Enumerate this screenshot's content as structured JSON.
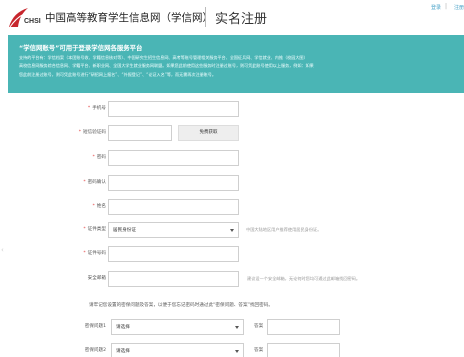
{
  "header": {
    "logo_en": "CHSI",
    "logo_cn": "中国高等教育学生信息网（学信网）",
    "page_title": "实名注册",
    "login_link": "登录",
    "separator": "|",
    "register_link": "注册"
  },
  "banner": {
    "title": "“学信网账号”可用于登录学信网各服务平台",
    "lines": [
      "支持的平台有：学信档案（本团账号收、学籍信息核对等）、中国研究生招生信息网、高考等账号管理相关服务平台、全国征兵网、学信就业、内推（校园大图）",
      "高校信息网服务综合信息网、学籍平台、新职业网、全国大学生就业服务网联盟。如果您此前使用这些服务时注册过账号，则可凭此账号使用以上服务，例如：如果",
      "您此前注册过账号，则可凭此账号进行“研招网上报名”、“外报登记”、“论证入名”等，而无需再次注册账号。"
    ]
  },
  "form": {
    "phone": {
      "label": "手机号",
      "required": true,
      "value": ""
    },
    "sms_code": {
      "label": "短信验证码",
      "required": true,
      "value": "",
      "button": "免费获取"
    },
    "password": {
      "label": "密码",
      "required": true,
      "value": ""
    },
    "password_confirm": {
      "label": "密码确认",
      "required": true,
      "value": ""
    },
    "name": {
      "label": "姓名",
      "required": true,
      "value": ""
    },
    "id_type": {
      "label": "证件类型",
      "required": true,
      "value": "居民身份证",
      "hint": "中国大陆地区用户推荐使用居民身份证。"
    },
    "id_number": {
      "label": "证件号码",
      "required": true,
      "value": ""
    },
    "email": {
      "label": "安全邮箱",
      "required": false,
      "value": "",
      "hint": "建议设一个安全邮箱，无论何时您均可通过此邮箱找回密码。"
    },
    "notice": "请牢记您设置的密保问题及答案，以便于您忘记密码时通过此“密保问题、答案”找回密码。",
    "q1": {
      "label": "密保问题1",
      "value": "请选择",
      "answer_label": "答案"
    },
    "q2": {
      "label": "密保问题2",
      "value": "请选择",
      "answer_label": "答案"
    }
  },
  "colors": {
    "banner_bg": "#4ab5b5",
    "required_star": "#e23b3b",
    "link": "#4aa3c8"
  }
}
